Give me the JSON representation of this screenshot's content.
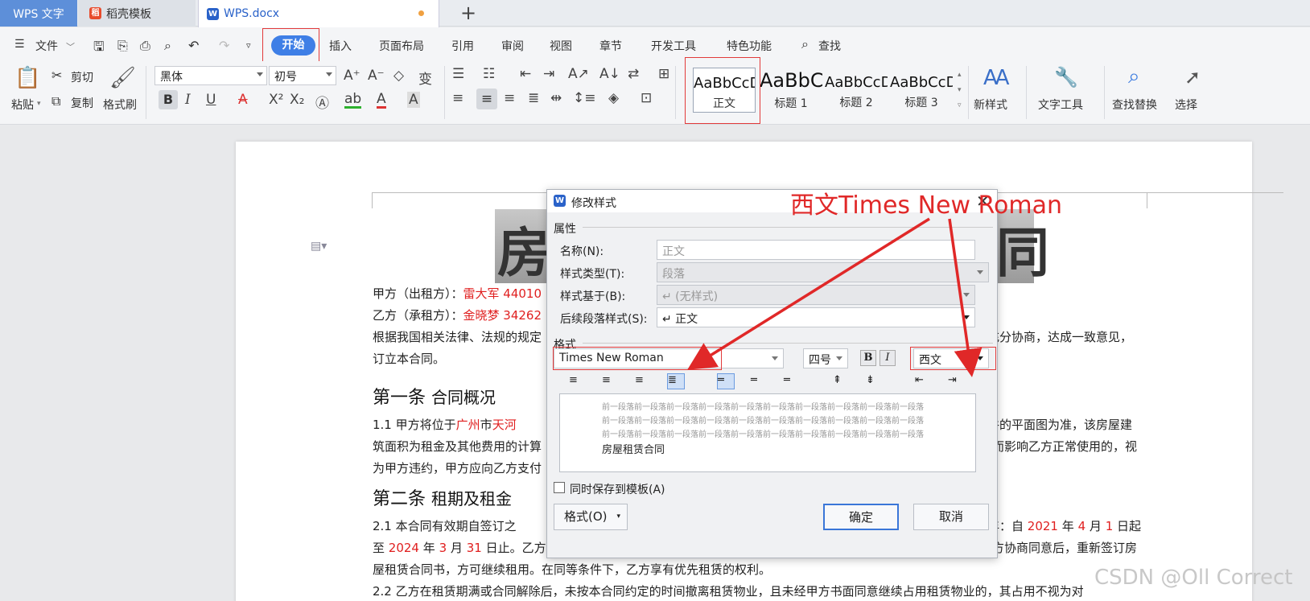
{
  "tabs": {
    "wps": "WPS 文字",
    "daoke": "稻壳模板",
    "doc": "WPS.docx"
  },
  "menu": {
    "file": "文件",
    "items": [
      "开始",
      "插入",
      "页面布局",
      "引用",
      "审阅",
      "视图",
      "章节",
      "开发工具",
      "特色功能"
    ],
    "search": "查找"
  },
  "ribbon": {
    "paste": "粘贴",
    "cut": "剪切",
    "copy": "复制",
    "format_painter": "格式刷",
    "font": "黑体",
    "size": "初号",
    "styles": [
      {
        "preview": "AaBbCcDd",
        "label": "正文"
      },
      {
        "preview": "AaBbC",
        "label": "标题 1"
      },
      {
        "preview": "AaBbCcDd",
        "label": "标题 2"
      },
      {
        "preview": "AaBbCcDd",
        "label": "标题 3"
      }
    ],
    "new_style": "新样式",
    "text_tools": "文字工具",
    "find_replace": "查找替换",
    "select": "选择"
  },
  "doc": {
    "party_a_label": "甲方（出租方）：",
    "party_a": "雷大军 44010",
    "party_b_label": "乙方（承租方）：",
    "party_b": "金晓梦 34262",
    "law": "根据我国相关法律、法规的规定",
    "law_end": "充分协商，达成一致意见，",
    "conclude": "订立本合同。",
    "art1": "第一条",
    "art1_title": "合同概况",
    "c11_num": "1.1",
    "c11": "甲方将位于",
    "c11_city": "广州",
    "c11_city2": "市",
    "c11_dist": "天河",
    "c11_end": "件的平面图为准，该房屋建",
    "c11b": "筑面积为租金及其他费用的计算",
    "c11b_end": "而影响乙方正常使用的，视",
    "c11c": "为甲方违约，甲方应向乙方支付",
    "art2": "第二条",
    "art2_title": "租期及租金",
    "c21_num": "2.1",
    "c21": "本合同有效期自签订之",
    "c21_end1": "年：自",
    "c21_y": "2021",
    "c21_y_unit": "年",
    "c21_m": "4",
    "c21_m_unit": "月",
    "c21_d": "1",
    "c21_d_unit": "日起",
    "c21b_pre": "至",
    "c21b_y": "2024",
    "c21b_y_unit": "年",
    "c21b_m": "3",
    "c21b_m_unit": "月",
    "c21b_d": "31",
    "c21b_d_unit": "日止。乙方",
    "c21b_end": "方协商同意后，重新签订房",
    "c21c": "屋租赁合同书，方可继续租用。在同等条件下，乙方享有优先租赁的权利。",
    "c22_num": "2.2",
    "c22": "乙方在租赁期满或合同解除后，未按本合同约定的时间撤离租赁物业，且未经甲方书面同意继续占用租赁物业的，其占用不视为对"
  },
  "dialog": {
    "title": "修改样式",
    "props": "属性",
    "name_label": "名称(N):",
    "name_val": "正文",
    "type_label": "样式类型(T):",
    "type_val": "段落",
    "based_label": "样式基于(B):",
    "based_val": "↵ (无样式)",
    "next_label": "后续段落样式(S):",
    "next_val": "↵ 正文",
    "format": "格式",
    "font": "Times New Roman",
    "size": "四号",
    "script": "西文",
    "preview_prev": "前一段落前一段落前一段落前一段落前一段落前一段落前一段落前一段落前一段落前一段落",
    "preview_text": "房屋租赁合同",
    "save_template": "同时保存到模板(A)",
    "format_btn": "格式(O)",
    "ok": "确定",
    "cancel": "取消"
  },
  "annotation": "西文Times New Roman",
  "watermark": "CSDN @Oll Correct"
}
